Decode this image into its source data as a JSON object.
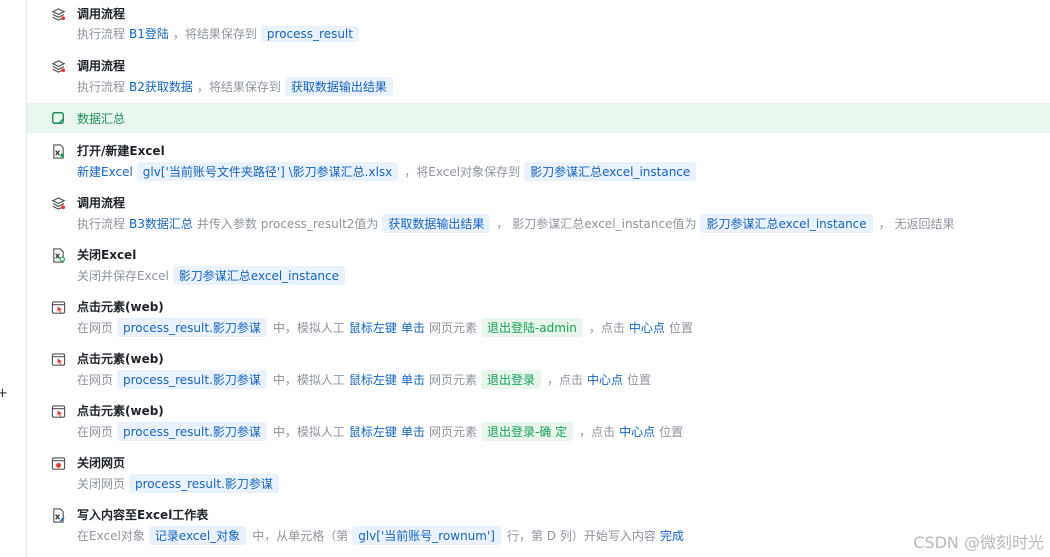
{
  "watermark": "CSDN @微刻时光",
  "group_title": "数据汇总",
  "steps": [
    {
      "title": "调用流程",
      "icon": "layers-icon",
      "desc": [
        {
          "k": "t",
          "v": "执行流程"
        },
        {
          "k": "l",
          "v": "B1登陆"
        },
        {
          "k": "t",
          "v": "，将结果保存到"
        },
        {
          "k": "g",
          "v": "process_result"
        }
      ]
    },
    {
      "title": "调用流程",
      "icon": "layers-icon",
      "desc": [
        {
          "k": "t",
          "v": "执行流程"
        },
        {
          "k": "l",
          "v": "B2获取数据"
        },
        {
          "k": "t",
          "v": "，将结果保存到"
        },
        {
          "k": "g",
          "v": "获取数据输出结果"
        }
      ]
    },
    {
      "title": "打开/新建Excel",
      "icon": "excel-open-icon",
      "desc": [
        {
          "k": "l",
          "v": "新建Excel"
        },
        {
          "k": "g",
          "v": "glv['当前账号文件夹路径'] \\影刀参谋汇总.xlsx"
        },
        {
          "k": "t",
          "v": "，将Excel对象保存到"
        },
        {
          "k": "g",
          "v": "影刀参谋汇总excel_instance"
        }
      ]
    },
    {
      "title": "调用流程",
      "icon": "layers-icon",
      "desc": [
        {
          "k": "t",
          "v": "执行流程"
        },
        {
          "k": "l",
          "v": "B3数据汇总"
        },
        {
          "k": "t",
          "v": "并传入参数 process_result2值为"
        },
        {
          "k": "g",
          "v": "获取数据输出结果"
        },
        {
          "k": "t",
          "v": "，  影刀参谋汇总excel_instance值为"
        },
        {
          "k": "g",
          "v": "影刀参谋汇总excel_instance"
        },
        {
          "k": "t",
          "v": "，  无返回结果"
        }
      ]
    },
    {
      "title": "关闭Excel",
      "icon": "excel-close-icon",
      "desc": [
        {
          "k": "t",
          "v": "关闭并保存Excel"
        },
        {
          "k": "g",
          "v": "影刀参谋汇总excel_instance"
        }
      ]
    },
    {
      "title": "点击元素(web)",
      "icon": "web-click-icon",
      "desc": [
        {
          "k": "t",
          "v": "在网页"
        },
        {
          "k": "g",
          "v": "process_result.影刀参谋"
        },
        {
          "k": "t",
          "v": "中，模拟人工"
        },
        {
          "k": "l",
          "v": "鼠标左键"
        },
        {
          "k": "l",
          "v": "单击"
        },
        {
          "k": "t",
          "v": "网页元素"
        },
        {
          "k": "e",
          "v": "退出登陆-admin"
        },
        {
          "k": "t",
          "v": "，点击"
        },
        {
          "k": "l",
          "v": "中心点"
        },
        {
          "k": "t",
          "v": "位置"
        }
      ]
    },
    {
      "title": "点击元素(web)",
      "icon": "web-click-icon",
      "desc": [
        {
          "k": "t",
          "v": "在网页"
        },
        {
          "k": "g",
          "v": "process_result.影刀参谋"
        },
        {
          "k": "t",
          "v": "中，模拟人工"
        },
        {
          "k": "l",
          "v": "鼠标左键"
        },
        {
          "k": "l",
          "v": "单击"
        },
        {
          "k": "t",
          "v": "网页元素"
        },
        {
          "k": "e",
          "v": "退出登录"
        },
        {
          "k": "t",
          "v": "，点击"
        },
        {
          "k": "l",
          "v": "中心点"
        },
        {
          "k": "t",
          "v": "位置"
        }
      ]
    },
    {
      "title": "点击元素(web)",
      "icon": "web-click-icon",
      "desc": [
        {
          "k": "t",
          "v": "在网页"
        },
        {
          "k": "g",
          "v": "process_result.影刀参谋"
        },
        {
          "k": "t",
          "v": "中，模拟人工"
        },
        {
          "k": "l",
          "v": "鼠标左键"
        },
        {
          "k": "l",
          "v": "单击"
        },
        {
          "k": "t",
          "v": "网页元素"
        },
        {
          "k": "e",
          "v": "退出登录-确 定"
        },
        {
          "k": "t",
          "v": "，点击"
        },
        {
          "k": "l",
          "v": "中心点"
        },
        {
          "k": "t",
          "v": "位置"
        }
      ]
    },
    {
      "title": "关闭网页",
      "icon": "web-close-icon",
      "desc": [
        {
          "k": "t",
          "v": "关闭网页"
        },
        {
          "k": "g",
          "v": "process_result.影刀参谋"
        }
      ]
    },
    {
      "title": "写入内容至Excel工作表",
      "icon": "excel-write-icon",
      "desc": [
        {
          "k": "t",
          "v": "在Excel对象"
        },
        {
          "k": "g",
          "v": "记录excel_对象"
        },
        {
          "k": "t",
          "v": "中，从单元格（第"
        },
        {
          "k": "g",
          "v": "glv['当前账号_rownum']"
        },
        {
          "k": "t",
          "v": "行，第 D 列）开始写入内容"
        },
        {
          "k": "l",
          "v": "完成"
        }
      ]
    }
  ]
}
